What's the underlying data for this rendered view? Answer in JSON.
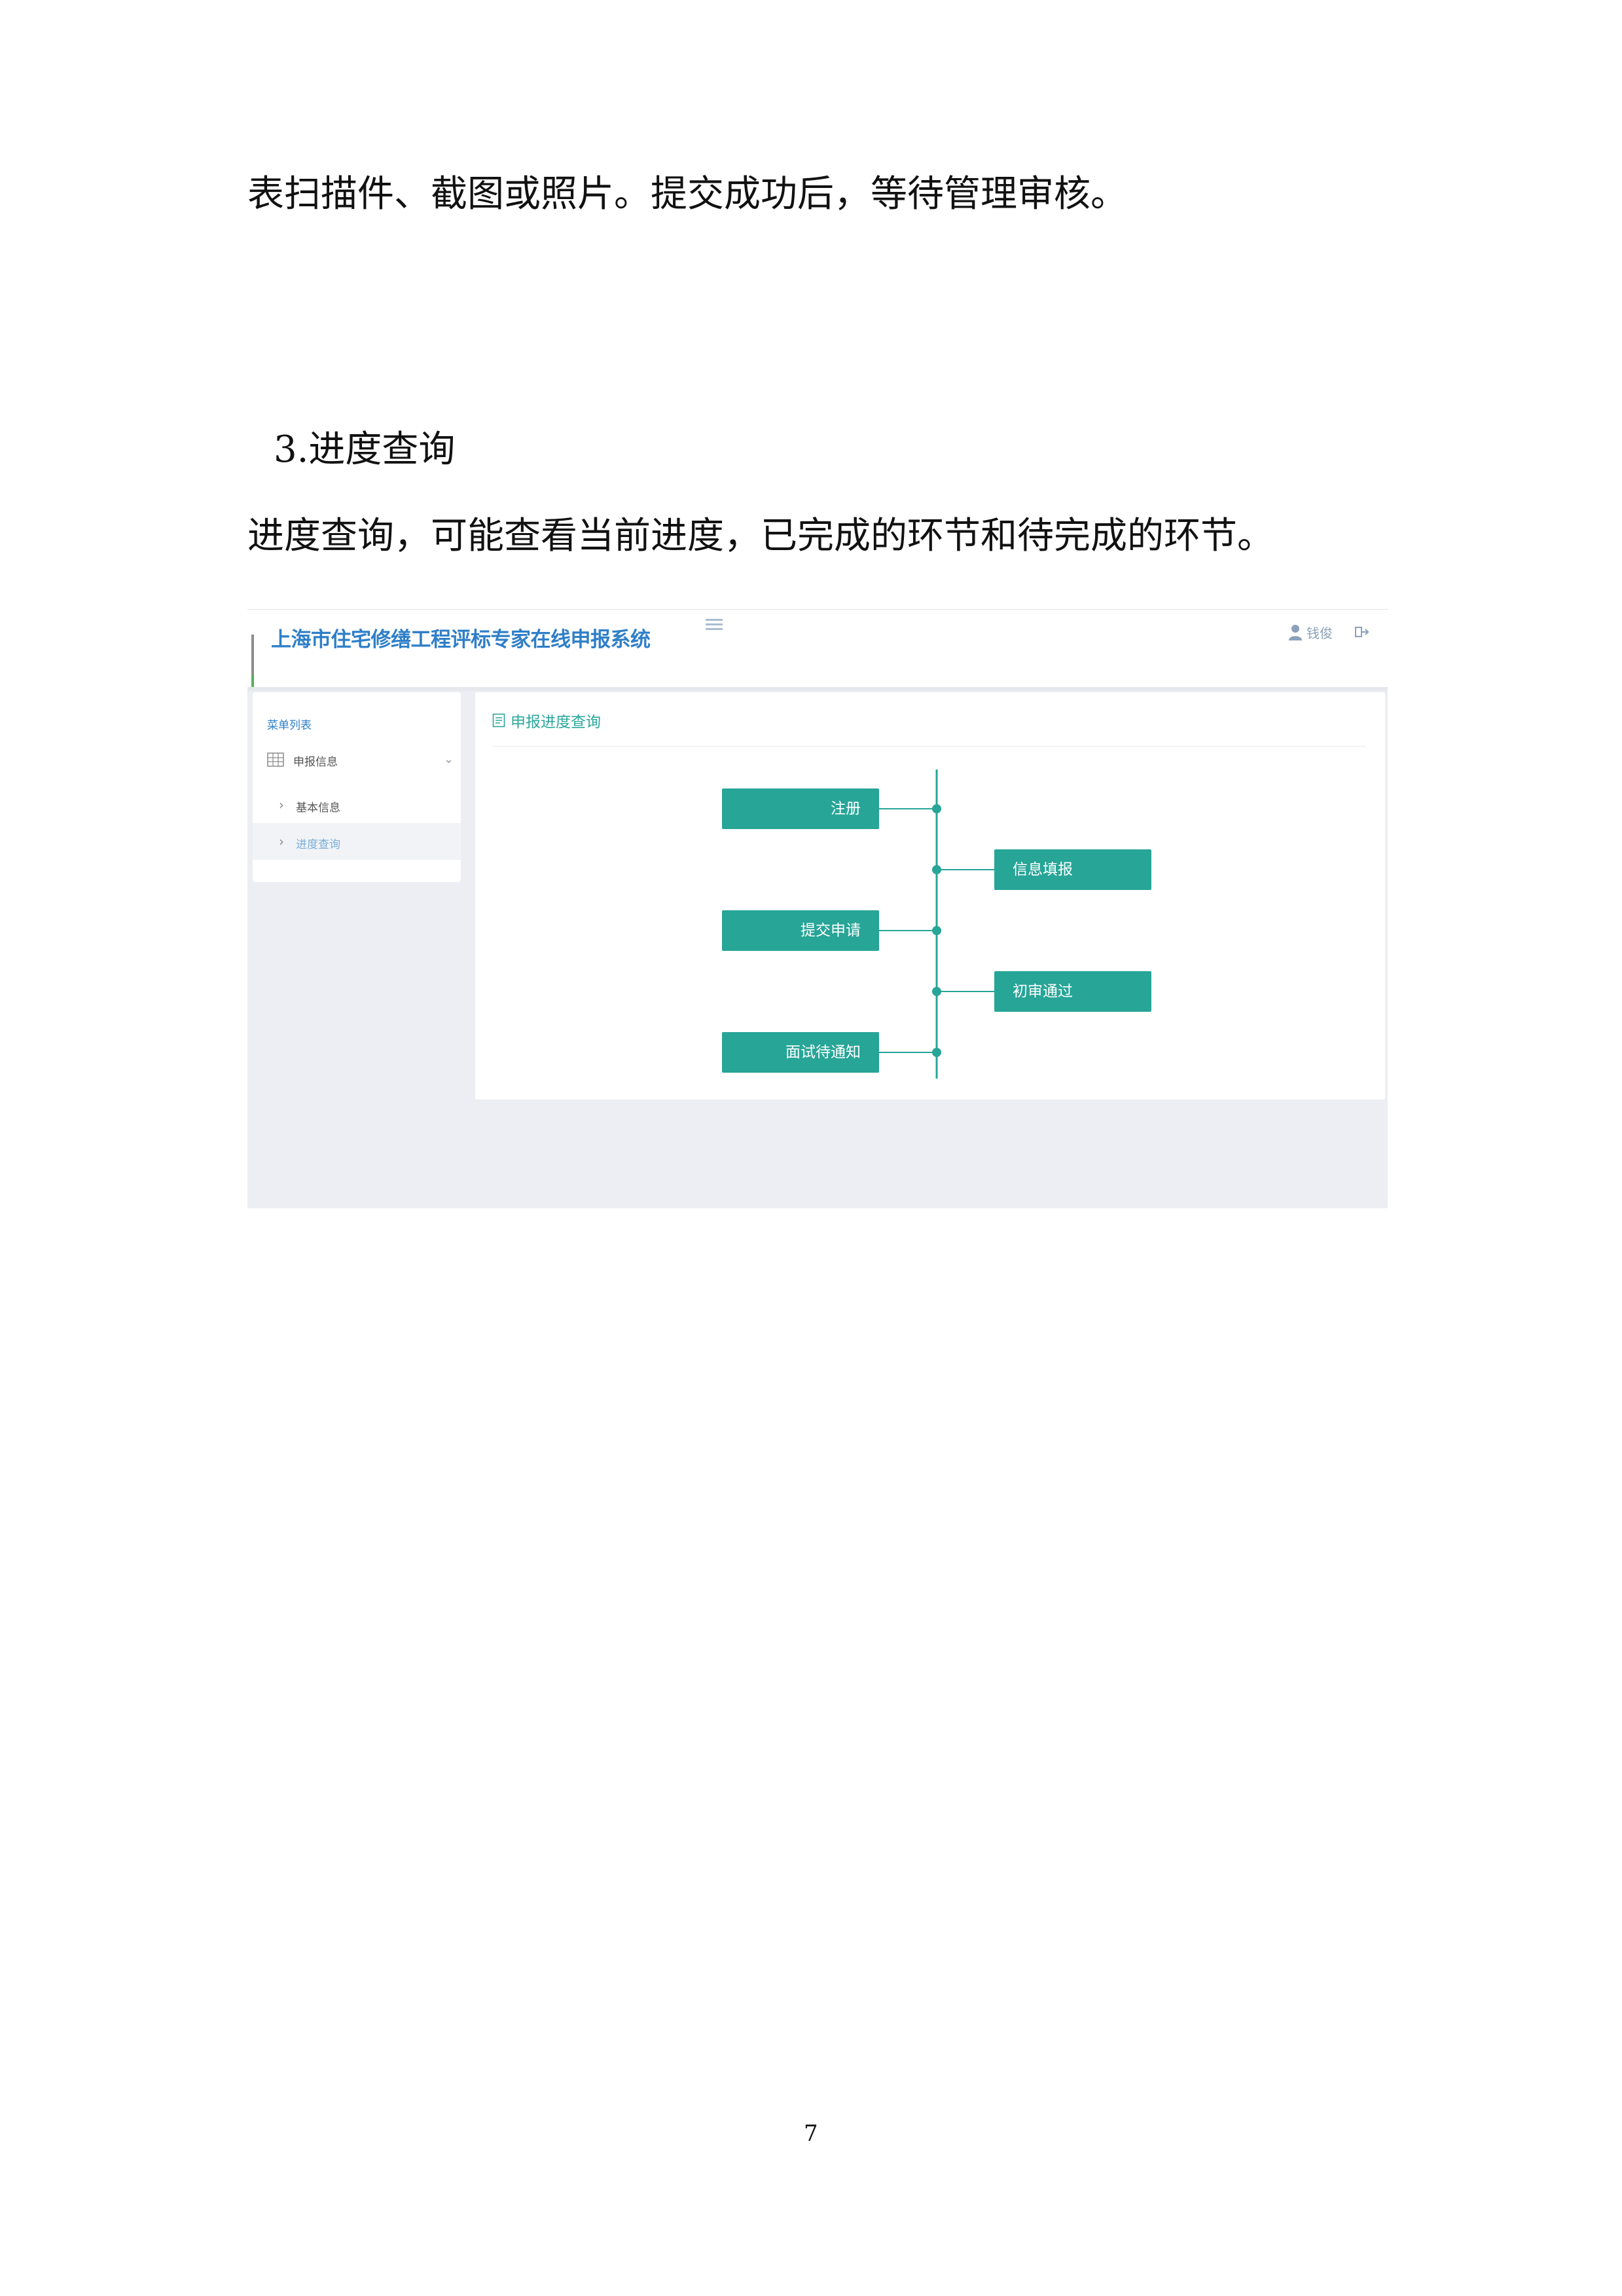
{
  "document": {
    "paragraph_1": "表扫描件、截图或照片。提交成功后，等待管理审核。",
    "heading": "3.进度查询",
    "paragraph_2": "进度查询，可能查看当前进度，已完成的环节和待完成的环节。",
    "page_number": "7"
  },
  "screenshot": {
    "app_title": "上海市住宅修缮工程评标专家在线申报系统",
    "header": {
      "menu_toggle_icon": "hamburger-icon",
      "user_icon": "user-icon",
      "user_name": "钱俊",
      "logout_icon": "logout-icon"
    },
    "sidebar": {
      "menu_title": "菜单列表",
      "group": {
        "icon": "grid-icon",
        "label": "申报信息"
      },
      "items": [
        {
          "label": "基本信息",
          "active": false
        },
        {
          "label": "进度查询",
          "active": true
        }
      ]
    },
    "content": {
      "title_icon": "document-icon",
      "title": "申报进度查询",
      "steps": [
        {
          "label": "注册",
          "side": "left"
        },
        {
          "label": "信息填报",
          "side": "right"
        },
        {
          "label": "提交申请",
          "side": "left"
        },
        {
          "label": "初审通过",
          "side": "right"
        },
        {
          "label": "面试待通知",
          "side": "left"
        }
      ]
    },
    "colors": {
      "accent_teal": "#27a597",
      "title_blue": "#2f7fc8",
      "background_gray": "#eceef3"
    }
  }
}
